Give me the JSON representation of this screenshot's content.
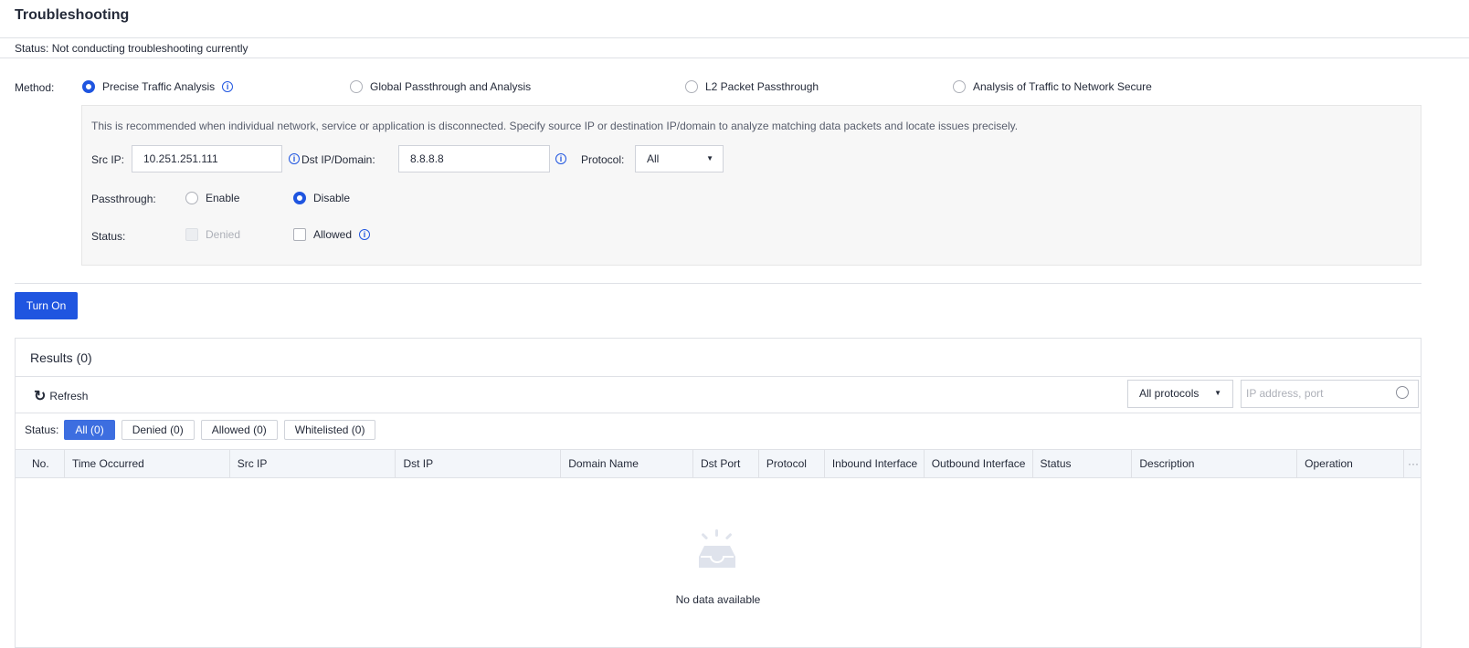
{
  "page": {
    "title": "Troubleshooting",
    "status": "Status: Not conducting troubleshooting currently"
  },
  "method": {
    "label": "Method:",
    "options": [
      "Precise Traffic Analysis",
      "Global Passthrough and Analysis",
      "L2 Packet Passthrough",
      "Analysis of Traffic to Network Secure"
    ],
    "selected": "Precise Traffic Analysis"
  },
  "panel": {
    "description": "This is recommended when individual network, service or application is disconnected. Specify source IP or destination IP/domain to analyze matching data packets and locate issues precisely.",
    "src_ip_label": "Src IP:",
    "src_ip": "10.251.251.111",
    "dst_label": "Dst IP/Domain:",
    "dst": "8.8.8.8",
    "protocol_label": "Protocol:",
    "protocol": "All",
    "passthrough_label": "Passthrough:",
    "passthrough_options": [
      "Enable",
      "Disable"
    ],
    "passthrough_selected": "Disable",
    "status_label": "Status:",
    "denied": "Denied",
    "allowed": "Allowed"
  },
  "turn_on": "Turn On",
  "results": {
    "title": "Results (0)",
    "refresh": "Refresh",
    "protocol_filter": "All protocols",
    "search_placeholder": "IP address, port",
    "status_label": "Status:",
    "chips": [
      "All (0)",
      "Denied (0)",
      "Allowed (0)",
      "Whitelisted (0)"
    ],
    "columns": [
      "No.",
      "Time Occurred",
      "Src IP",
      "Dst IP",
      "Domain Name",
      "Dst Port",
      "Protocol",
      "Inbound Interface",
      "Outbound Interface",
      "Status",
      "Description",
      "Operation"
    ],
    "more": "···",
    "empty": "No data available"
  },
  "colors": {
    "accent": "#1f55e0"
  }
}
